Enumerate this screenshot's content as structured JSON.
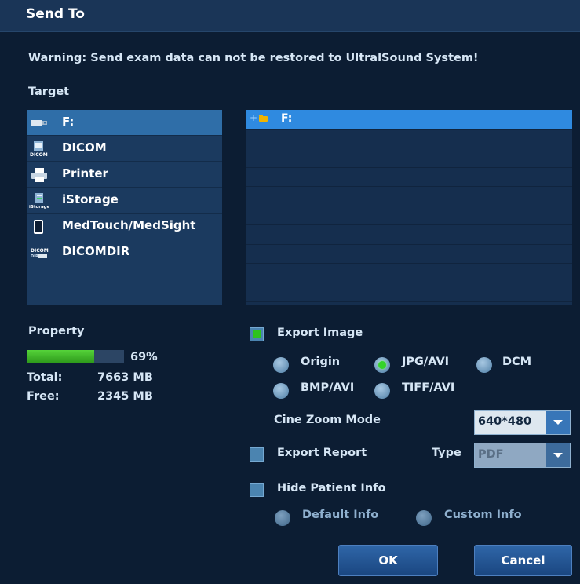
{
  "window": {
    "title": "Send To"
  },
  "warning": "Warning: Send exam data can not be restored to UltralSound System!",
  "target": {
    "label": "Target",
    "items": [
      {
        "label": "F:",
        "icon": "usb-drive-icon",
        "selected": true
      },
      {
        "label": "DICOM",
        "icon": "dicom-icon",
        "selected": false
      },
      {
        "label": "Printer",
        "icon": "printer-icon",
        "selected": false
      },
      {
        "label": "iStorage",
        "icon": "istorage-icon",
        "selected": false
      },
      {
        "label": "MedTouch/MedSight",
        "icon": "mobile-device-icon",
        "selected": false
      },
      {
        "label": "DICOMDIR",
        "icon": "dicomdir-icon",
        "selected": false
      }
    ]
  },
  "tree": {
    "items": [
      {
        "label": "F:",
        "expander": "+",
        "icon": "folder-icon",
        "selected": true
      }
    ]
  },
  "property": {
    "label": "Property",
    "usage_percent": 69,
    "usage_text": "69%",
    "total_label": "Total:",
    "total_value": "7663 MB",
    "free_label": "Free:",
    "free_value": "2345 MB"
  },
  "export_image": {
    "label": "Export Image",
    "checked": true,
    "formats": [
      {
        "label": "Origin",
        "selected": false
      },
      {
        "label": "JPG/AVI",
        "selected": true
      },
      {
        "label": "DCM",
        "selected": false
      },
      {
        "label": "BMP/AVI",
        "selected": false
      },
      {
        "label": "TIFF/AVI",
        "selected": false
      }
    ],
    "cine_zoom_label": "Cine Zoom Mode",
    "cine_zoom_value": "640*480"
  },
  "export_report": {
    "label": "Export Report",
    "checked": false,
    "type_label": "Type",
    "type_value": "PDF"
  },
  "hide_patient": {
    "label": "Hide Patient Info",
    "checked": false,
    "options": [
      {
        "label": "Default Info",
        "selected": false
      },
      {
        "label": "Custom Info",
        "selected": false
      }
    ]
  },
  "buttons": {
    "ok": "OK",
    "cancel": "Cancel"
  },
  "colors": {
    "background": "#0c1d33",
    "selection": "#2f6ea8",
    "tree_selection": "#2f8ae0",
    "progress_fill": "#2e9a1b",
    "radio_selected": "#34d32a"
  }
}
